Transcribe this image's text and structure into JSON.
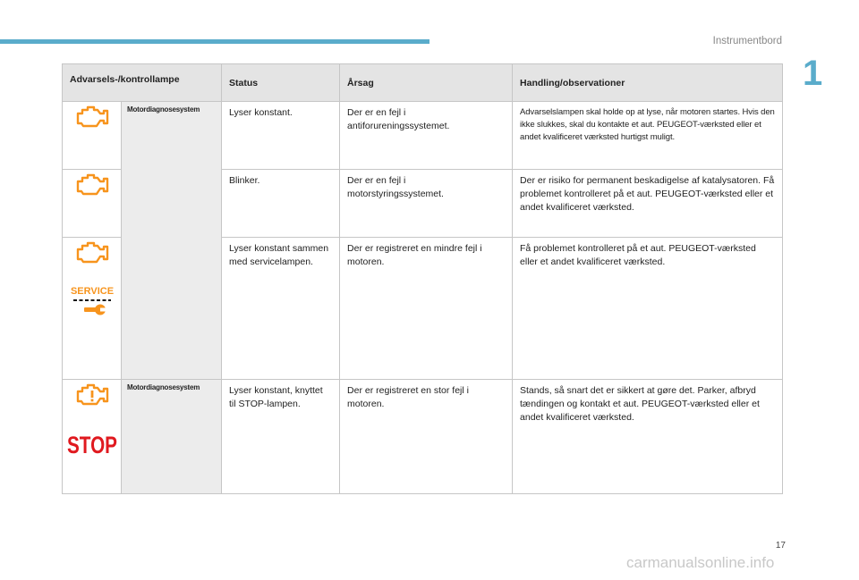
{
  "header": {
    "section_title": "Instrumentbord",
    "chapter_number": "1",
    "page_number": "17",
    "accent_color": "#5aaccb"
  },
  "table": {
    "columns": [
      "Advarsels-/kontrollampe",
      "Status",
      "Årsag",
      "Handling/observationer"
    ],
    "rows": [
      {
        "icons": [
          "engine-icon"
        ],
        "name": "Motordiagnosesystem",
        "status": "Lyser konstant.",
        "cause": "Der er en fejl i antiforureningssystemet.",
        "action": "Advarselslampen skal holde op at lyse, når motoren startes. Hvis den ikke slukkes, skal du kontakte et aut. PEUGEOT-værksted eller et andet kvalificeret værksted hurtigst muligt."
      },
      {
        "icons": [
          "engine-icon"
        ],
        "name": "",
        "status": "Blinker.",
        "cause": "Der er en fejl i motorstyringssystemet.",
        "action": "Der er risiko for permanent beskadigelse af katalysatoren. Få problemet kontrolleret på et aut. PEUGEOT-værksted eller et andet kvalificeret værksted."
      },
      {
        "icons": [
          "engine-icon",
          "service-wrench-icon"
        ],
        "name": "",
        "status": "Lyser konstant sammen med servicelampen.",
        "cause": "Der er registreret en mindre fejl i motoren.",
        "action": "Få problemet kontrolleret på et aut. PEUGEOT-værksted eller et andet kvalificeret værksted."
      },
      {
        "icons": [
          "engine-exclamation-icon",
          "stop-icon"
        ],
        "name": "Motordiagnosesystem",
        "status": "Lyser konstant, knyttet til STOP-lampen.",
        "cause": "Der er registreret en stor fejl i motoren.",
        "action": "Stands, så snart det er sikkert at gøre det. Parker, afbryd tændingen og kontakt et aut. PEUGEOT-værksted eller et andet kvalificeret værksted."
      }
    ]
  },
  "labels": {
    "service": "SERVICE",
    "stop": "STOP"
  },
  "icon_colors": {
    "orange": "#f7941d",
    "red": "#e0191f"
  },
  "watermark": "carmanualsonline.info"
}
